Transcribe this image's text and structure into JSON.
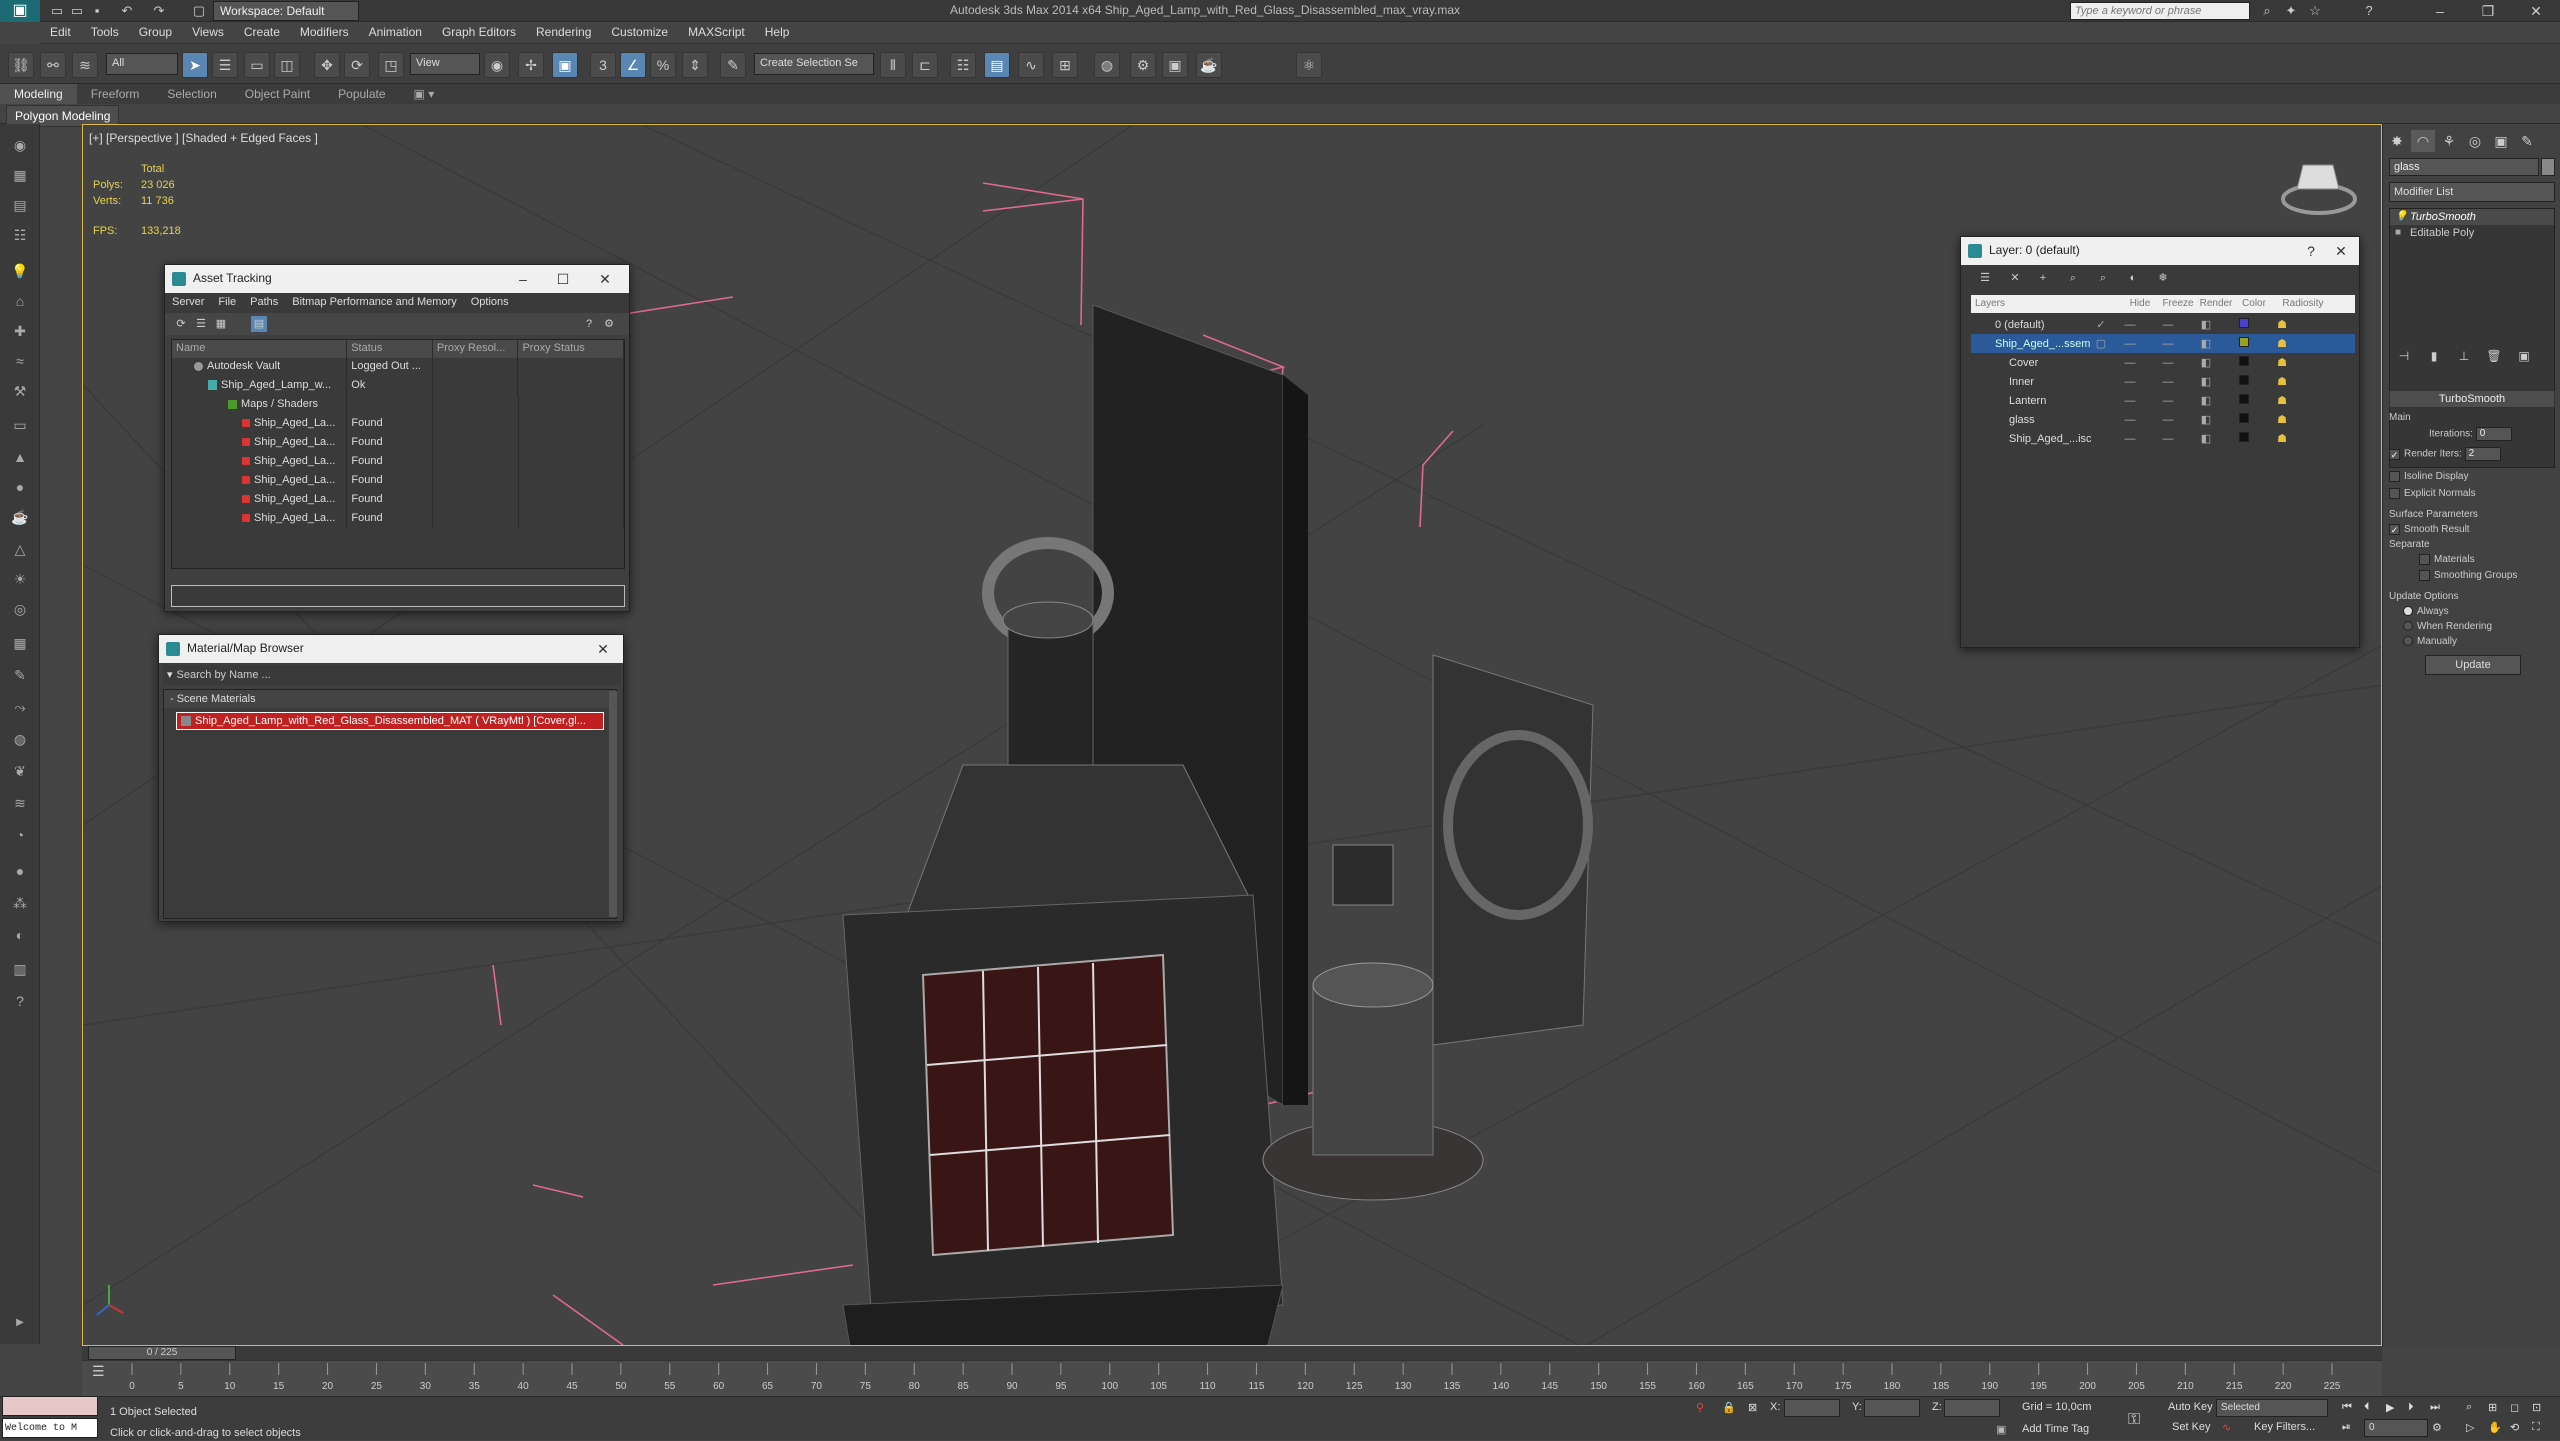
{
  "app": {
    "title": "Autodesk 3ds Max  2014 x64     Ship_Aged_Lamp_with_Red_Glass_Disassembled_max_vray.max",
    "workspace": "Workspace: Default",
    "search_placeholder": "Type a keyword or phrase"
  },
  "menu": [
    "Edit",
    "Tools",
    "Group",
    "Views",
    "Create",
    "Modifiers",
    "Animation",
    "Graph Editors",
    "Rendering",
    "Customize",
    "MAXScript",
    "Help"
  ],
  "toolbar": {
    "filter": "All",
    "ref_coord": "View",
    "selection_set": "Create Selection Se",
    "snap_count": "3",
    "counter": "1"
  },
  "ribbon": {
    "tabs": [
      "Modeling",
      "Freeform",
      "Selection",
      "Object Paint",
      "Populate"
    ],
    "active_tab": "Modeling",
    "sub": "Polygon Modeling"
  },
  "viewport": {
    "label": "[+] [Perspective ] [Shaded + Edged Faces ]",
    "stats": {
      "total": "Total",
      "polys_label": "Polys:",
      "polys": "23 026",
      "verts_label": "Verts:",
      "verts": "11 736",
      "fps_label": "FPS:",
      "fps": "133,218"
    }
  },
  "asset_tracking": {
    "title": "Asset Tracking",
    "menu": [
      "Server",
      "File",
      "Paths",
      "Bitmap Performance and Memory",
      "Options"
    ],
    "columns": [
      "Name",
      "Status",
      "Proxy Resol...",
      "Proxy Status"
    ],
    "rows": [
      {
        "name": "Autodesk Vault",
        "status": "Logged Out ..."
      },
      {
        "name": "Ship_Aged_Lamp_w...",
        "status": "Ok"
      },
      {
        "name": "Maps / Shaders",
        "status": ""
      },
      {
        "name": "Ship_Aged_La...",
        "status": "Found"
      },
      {
        "name": "Ship_Aged_La...",
        "status": "Found"
      },
      {
        "name": "Ship_Aged_La...",
        "status": "Found"
      },
      {
        "name": "Ship_Aged_La...",
        "status": "Found"
      },
      {
        "name": "Ship_Aged_La...",
        "status": "Found"
      },
      {
        "name": "Ship_Aged_La...",
        "status": "Found"
      }
    ]
  },
  "material_browser": {
    "title": "Material/Map Browser",
    "search": "Search by Name ...",
    "group": "- Scene Materials",
    "item": "Ship_Aged_Lamp_with_Red_Glass_Disassembled_MAT ( VRayMtl ) [Cover,gl..."
  },
  "layer_manager": {
    "title": "Layer: 0 (default)",
    "columns": [
      "Layers",
      "Hide",
      "Freeze",
      "Render",
      "Color",
      "Radiosity"
    ],
    "rows": [
      {
        "name": "0 (default)",
        "color": "#4a3fd0"
      },
      {
        "name": "Ship_Aged_...ssem",
        "color": "#9aa020"
      },
      {
        "name": "Cover",
        "color": "#111111"
      },
      {
        "name": "Inner",
        "color": "#111111"
      },
      {
        "name": "Lantern",
        "color": "#111111"
      },
      {
        "name": "glass",
        "color": "#111111"
      },
      {
        "name": "Ship_Aged_...isc",
        "color": "#111111"
      }
    ]
  },
  "command_panel": {
    "object_name": "glass",
    "modifier_list": "Modifier List",
    "stack": [
      "TurboSmooth",
      "Editable Poly"
    ],
    "rollout": "TurboSmooth",
    "main": "Main",
    "iterations_label": "Iterations:",
    "iterations": "0",
    "render_iters_label": "Render Iters:",
    "render_iters": "2",
    "isoline": "Isoline Display",
    "explicit": "Explicit Normals",
    "surface": "Surface Parameters",
    "smooth_result": "Smooth Result",
    "separate": "Separate",
    "materials": "Materials",
    "smoothing_groups": "Smoothing Groups",
    "update_options": "Update Options",
    "always": "Always",
    "when_rendering": "When Rendering",
    "manually": "Manually",
    "update": "Update"
  },
  "timeline": {
    "slider": "0 / 225",
    "ticks": [
      "0",
      "5",
      "10",
      "15",
      "20",
      "25",
      "30",
      "35",
      "40",
      "45",
      "50",
      "55",
      "60",
      "65",
      "70",
      "75",
      "80",
      "85",
      "90",
      "95",
      "100",
      "105",
      "110",
      "115",
      "120",
      "125",
      "130",
      "135",
      "140",
      "145",
      "150",
      "155",
      "160",
      "165",
      "170",
      "175",
      "180",
      "185",
      "190",
      "195",
      "200",
      "205",
      "210",
      "215",
      "220",
      "225"
    ]
  },
  "status": {
    "mini_listener": "Welcome to M",
    "selected": "1 Object Selected",
    "prompt": "Click or click-and-drag to select objects",
    "x": "X:",
    "y": "Y:",
    "z": "Z:",
    "grid": "Grid = 10,0cm",
    "add_time_tag": "Add Time Tag",
    "auto_key": "Auto Key",
    "selected_mode": "Selected",
    "set_key": "Set Key",
    "key_filters": "Key Filters...",
    "frame": "0"
  },
  "colors": {
    "accent_blue": "#5a86b3",
    "selection_yellow": "#d8b94a",
    "bbox_pink": "#e06a8a",
    "found_red": "#d33"
  }
}
